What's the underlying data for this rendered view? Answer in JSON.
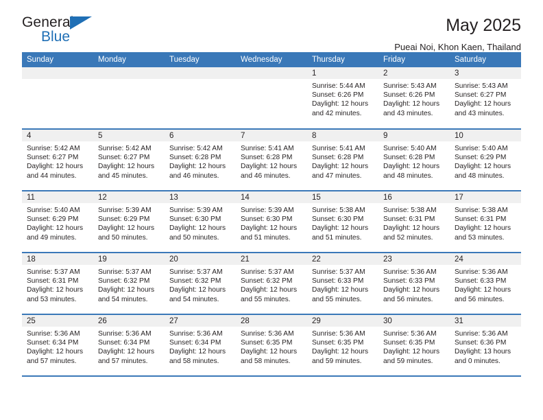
{
  "brand": {
    "name_part1": "General",
    "name_part2": "Blue",
    "accent_color": "#1f6fb5"
  },
  "header": {
    "title": "May 2025",
    "subtitle": "Pueai Noi, Khon Kaen, Thailand"
  },
  "theme": {
    "header_row_bg": "#3a78b8",
    "daynum_strip_bg": "#f0f0f0",
    "text_color": "#231f20"
  },
  "weekday_headers": [
    "Sunday",
    "Monday",
    "Tuesday",
    "Wednesday",
    "Thursday",
    "Friday",
    "Saturday"
  ],
  "weeks": [
    [
      {
        "day": "",
        "sunrise": "",
        "sunset": "",
        "daylight_line1": "",
        "daylight_line2": ""
      },
      {
        "day": "",
        "sunrise": "",
        "sunset": "",
        "daylight_line1": "",
        "daylight_line2": ""
      },
      {
        "day": "",
        "sunrise": "",
        "sunset": "",
        "daylight_line1": "",
        "daylight_line2": ""
      },
      {
        "day": "",
        "sunrise": "",
        "sunset": "",
        "daylight_line1": "",
        "daylight_line2": ""
      },
      {
        "day": "1",
        "sunrise": "Sunrise: 5:44 AM",
        "sunset": "Sunset: 6:26 PM",
        "daylight_line1": "Daylight: 12 hours",
        "daylight_line2": "and 42 minutes."
      },
      {
        "day": "2",
        "sunrise": "Sunrise: 5:43 AM",
        "sunset": "Sunset: 6:26 PM",
        "daylight_line1": "Daylight: 12 hours",
        "daylight_line2": "and 43 minutes."
      },
      {
        "day": "3",
        "sunrise": "Sunrise: 5:43 AM",
        "sunset": "Sunset: 6:27 PM",
        "daylight_line1": "Daylight: 12 hours",
        "daylight_line2": "and 43 minutes."
      }
    ],
    [
      {
        "day": "4",
        "sunrise": "Sunrise: 5:42 AM",
        "sunset": "Sunset: 6:27 PM",
        "daylight_line1": "Daylight: 12 hours",
        "daylight_line2": "and 44 minutes."
      },
      {
        "day": "5",
        "sunrise": "Sunrise: 5:42 AM",
        "sunset": "Sunset: 6:27 PM",
        "daylight_line1": "Daylight: 12 hours",
        "daylight_line2": "and 45 minutes."
      },
      {
        "day": "6",
        "sunrise": "Sunrise: 5:42 AM",
        "sunset": "Sunset: 6:28 PM",
        "daylight_line1": "Daylight: 12 hours",
        "daylight_line2": "and 46 minutes."
      },
      {
        "day": "7",
        "sunrise": "Sunrise: 5:41 AM",
        "sunset": "Sunset: 6:28 PM",
        "daylight_line1": "Daylight: 12 hours",
        "daylight_line2": "and 46 minutes."
      },
      {
        "day": "8",
        "sunrise": "Sunrise: 5:41 AM",
        "sunset": "Sunset: 6:28 PM",
        "daylight_line1": "Daylight: 12 hours",
        "daylight_line2": "and 47 minutes."
      },
      {
        "day": "9",
        "sunrise": "Sunrise: 5:40 AM",
        "sunset": "Sunset: 6:28 PM",
        "daylight_line1": "Daylight: 12 hours",
        "daylight_line2": "and 48 minutes."
      },
      {
        "day": "10",
        "sunrise": "Sunrise: 5:40 AM",
        "sunset": "Sunset: 6:29 PM",
        "daylight_line1": "Daylight: 12 hours",
        "daylight_line2": "and 48 minutes."
      }
    ],
    [
      {
        "day": "11",
        "sunrise": "Sunrise: 5:40 AM",
        "sunset": "Sunset: 6:29 PM",
        "daylight_line1": "Daylight: 12 hours",
        "daylight_line2": "and 49 minutes."
      },
      {
        "day": "12",
        "sunrise": "Sunrise: 5:39 AM",
        "sunset": "Sunset: 6:29 PM",
        "daylight_line1": "Daylight: 12 hours",
        "daylight_line2": "and 50 minutes."
      },
      {
        "day": "13",
        "sunrise": "Sunrise: 5:39 AM",
        "sunset": "Sunset: 6:30 PM",
        "daylight_line1": "Daylight: 12 hours",
        "daylight_line2": "and 50 minutes."
      },
      {
        "day": "14",
        "sunrise": "Sunrise: 5:39 AM",
        "sunset": "Sunset: 6:30 PM",
        "daylight_line1": "Daylight: 12 hours",
        "daylight_line2": "and 51 minutes."
      },
      {
        "day": "15",
        "sunrise": "Sunrise: 5:38 AM",
        "sunset": "Sunset: 6:30 PM",
        "daylight_line1": "Daylight: 12 hours",
        "daylight_line2": "and 51 minutes."
      },
      {
        "day": "16",
        "sunrise": "Sunrise: 5:38 AM",
        "sunset": "Sunset: 6:31 PM",
        "daylight_line1": "Daylight: 12 hours",
        "daylight_line2": "and 52 minutes."
      },
      {
        "day": "17",
        "sunrise": "Sunrise: 5:38 AM",
        "sunset": "Sunset: 6:31 PM",
        "daylight_line1": "Daylight: 12 hours",
        "daylight_line2": "and 53 minutes."
      }
    ],
    [
      {
        "day": "18",
        "sunrise": "Sunrise: 5:37 AM",
        "sunset": "Sunset: 6:31 PM",
        "daylight_line1": "Daylight: 12 hours",
        "daylight_line2": "and 53 minutes."
      },
      {
        "day": "19",
        "sunrise": "Sunrise: 5:37 AM",
        "sunset": "Sunset: 6:32 PM",
        "daylight_line1": "Daylight: 12 hours",
        "daylight_line2": "and 54 minutes."
      },
      {
        "day": "20",
        "sunrise": "Sunrise: 5:37 AM",
        "sunset": "Sunset: 6:32 PM",
        "daylight_line1": "Daylight: 12 hours",
        "daylight_line2": "and 54 minutes."
      },
      {
        "day": "21",
        "sunrise": "Sunrise: 5:37 AM",
        "sunset": "Sunset: 6:32 PM",
        "daylight_line1": "Daylight: 12 hours",
        "daylight_line2": "and 55 minutes."
      },
      {
        "day": "22",
        "sunrise": "Sunrise: 5:37 AM",
        "sunset": "Sunset: 6:33 PM",
        "daylight_line1": "Daylight: 12 hours",
        "daylight_line2": "and 55 minutes."
      },
      {
        "day": "23",
        "sunrise": "Sunrise: 5:36 AM",
        "sunset": "Sunset: 6:33 PM",
        "daylight_line1": "Daylight: 12 hours",
        "daylight_line2": "and 56 minutes."
      },
      {
        "day": "24",
        "sunrise": "Sunrise: 5:36 AM",
        "sunset": "Sunset: 6:33 PM",
        "daylight_line1": "Daylight: 12 hours",
        "daylight_line2": "and 56 minutes."
      }
    ],
    [
      {
        "day": "25",
        "sunrise": "Sunrise: 5:36 AM",
        "sunset": "Sunset: 6:34 PM",
        "daylight_line1": "Daylight: 12 hours",
        "daylight_line2": "and 57 minutes."
      },
      {
        "day": "26",
        "sunrise": "Sunrise: 5:36 AM",
        "sunset": "Sunset: 6:34 PM",
        "daylight_line1": "Daylight: 12 hours",
        "daylight_line2": "and 57 minutes."
      },
      {
        "day": "27",
        "sunrise": "Sunrise: 5:36 AM",
        "sunset": "Sunset: 6:34 PM",
        "daylight_line1": "Daylight: 12 hours",
        "daylight_line2": "and 58 minutes."
      },
      {
        "day": "28",
        "sunrise": "Sunrise: 5:36 AM",
        "sunset": "Sunset: 6:35 PM",
        "daylight_line1": "Daylight: 12 hours",
        "daylight_line2": "and 58 minutes."
      },
      {
        "day": "29",
        "sunrise": "Sunrise: 5:36 AM",
        "sunset": "Sunset: 6:35 PM",
        "daylight_line1": "Daylight: 12 hours",
        "daylight_line2": "and 59 minutes."
      },
      {
        "day": "30",
        "sunrise": "Sunrise: 5:36 AM",
        "sunset": "Sunset: 6:35 PM",
        "daylight_line1": "Daylight: 12 hours",
        "daylight_line2": "and 59 minutes."
      },
      {
        "day": "31",
        "sunrise": "Sunrise: 5:36 AM",
        "sunset": "Sunset: 6:36 PM",
        "daylight_line1": "Daylight: 13 hours",
        "daylight_line2": "and 0 minutes."
      }
    ]
  ]
}
